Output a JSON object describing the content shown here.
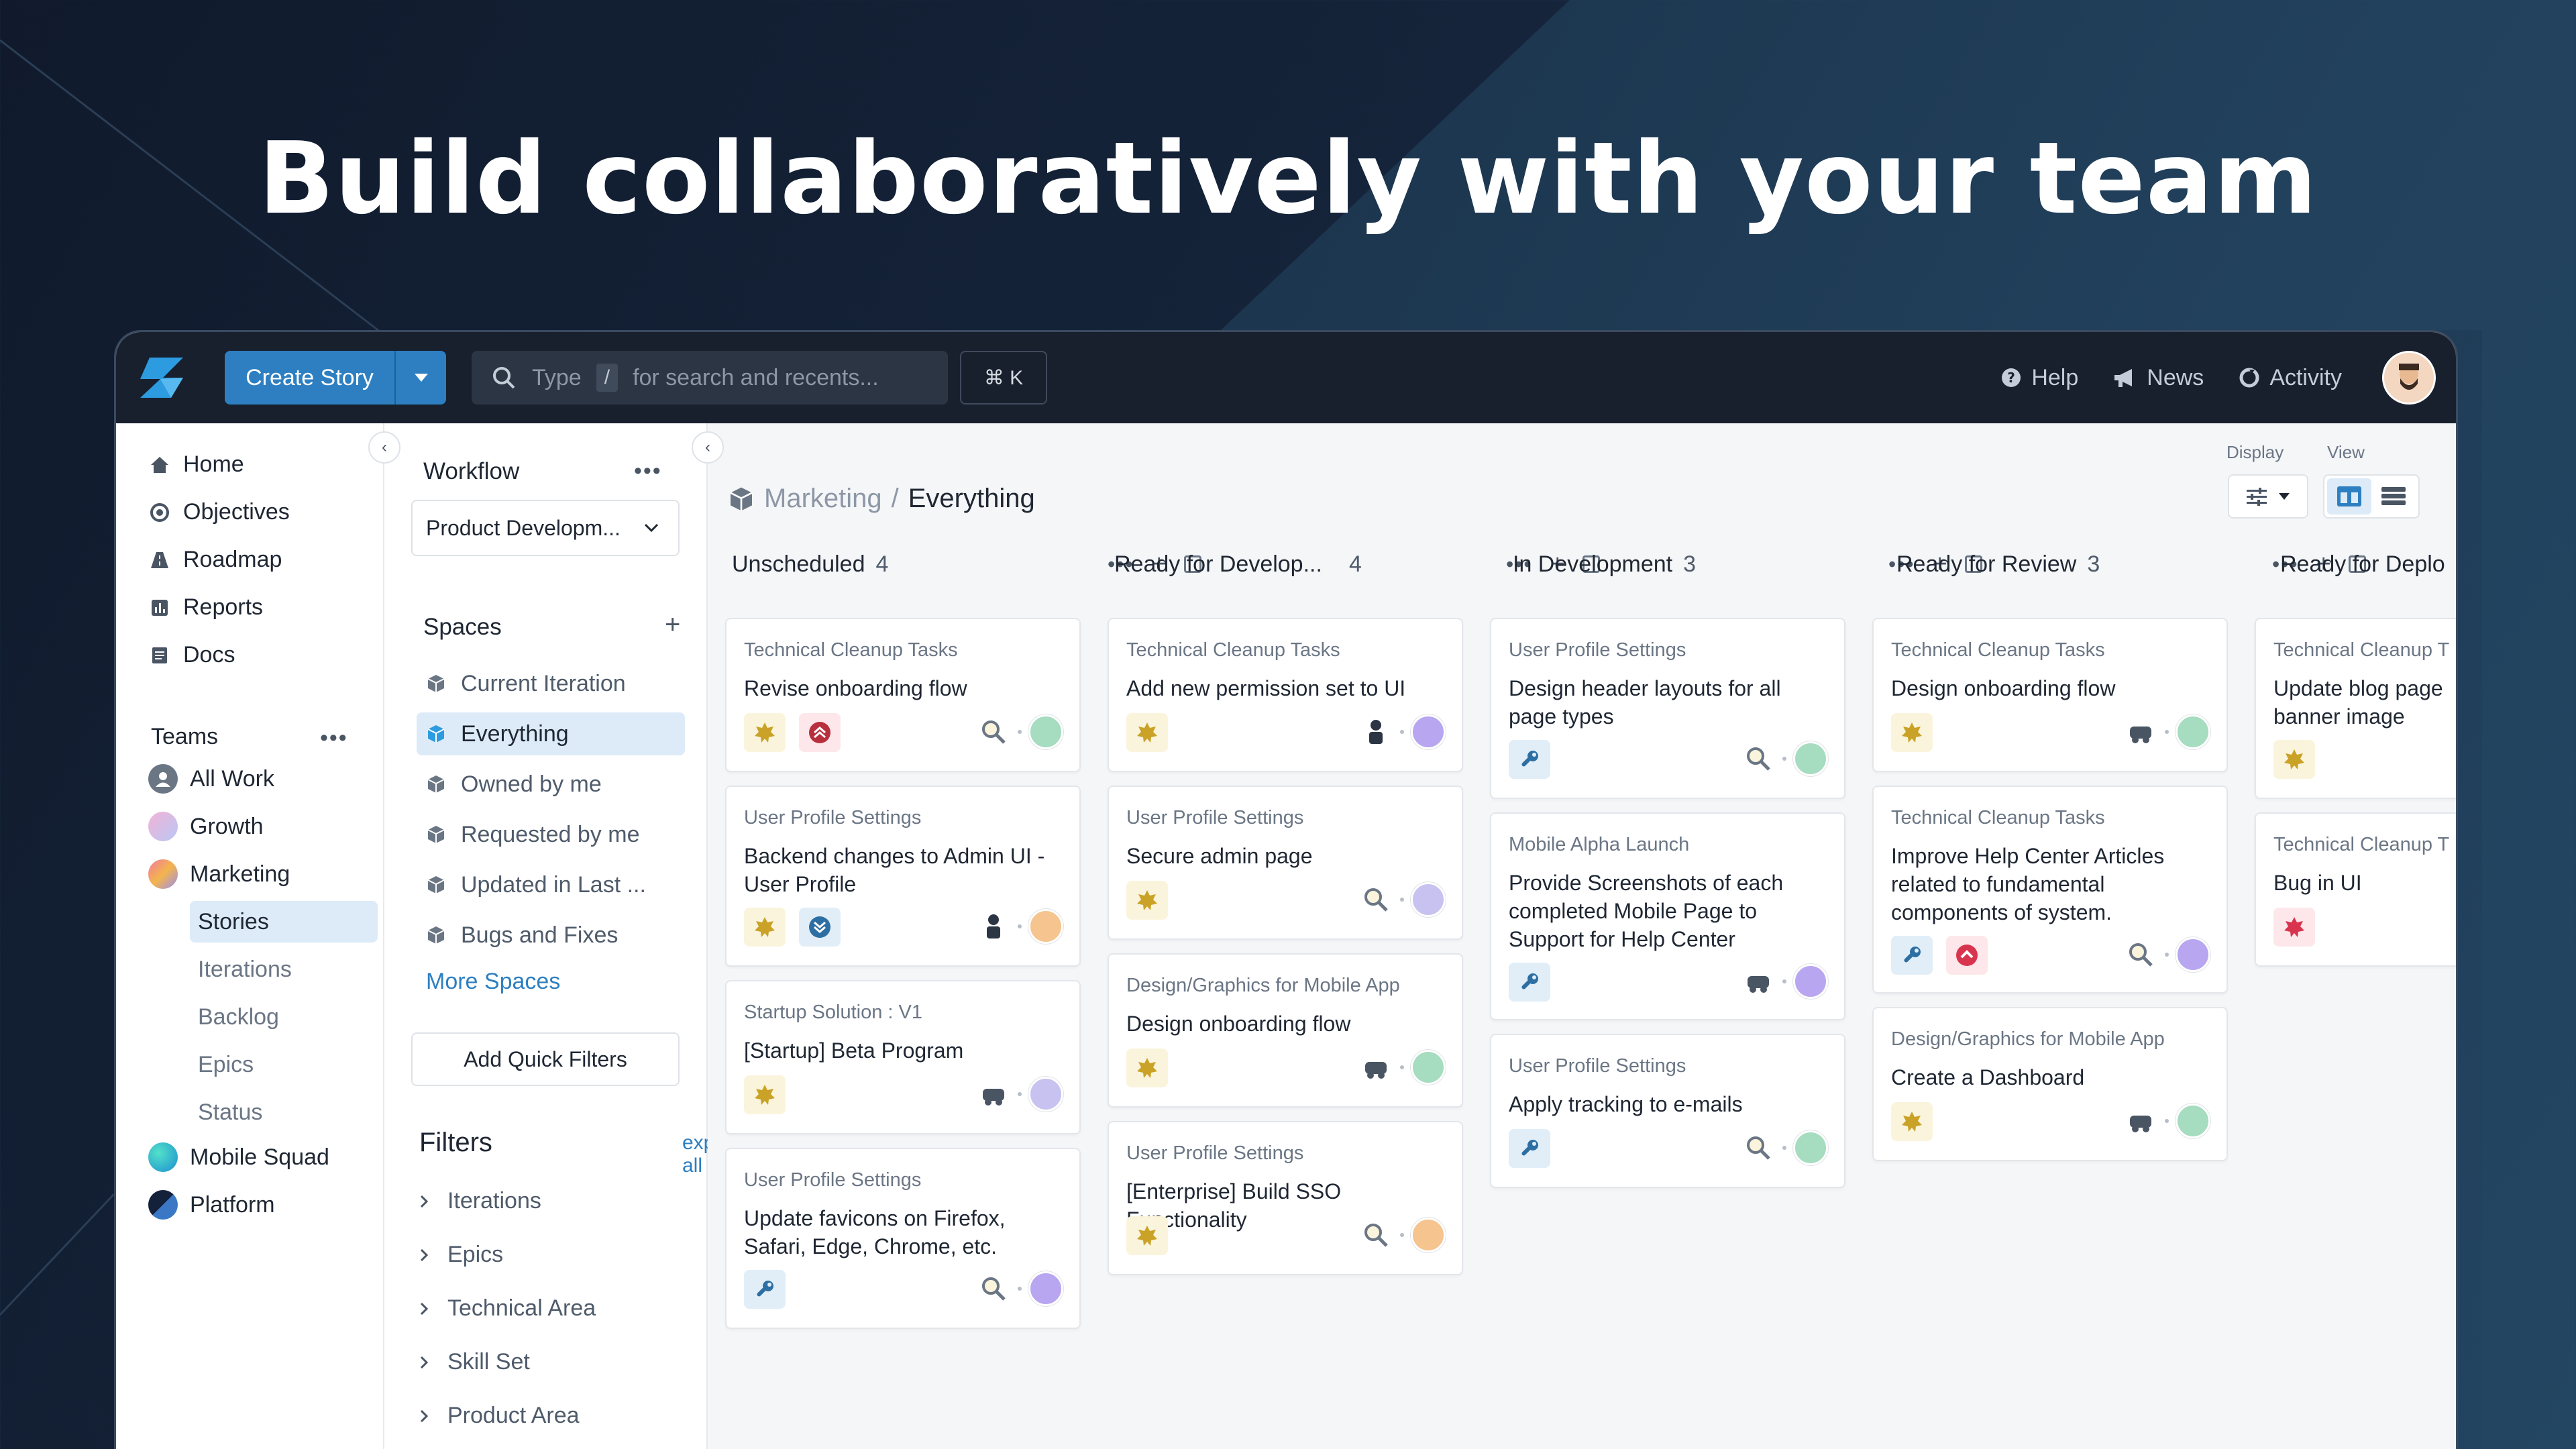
{
  "headline": "Build collaboratively with your team",
  "topbar": {
    "create_label": "Create Story",
    "search_type": "Type",
    "search_slash": "/",
    "search_placeholder": "for search and recents...",
    "shortcut": "⌘ K",
    "help": "Help",
    "news": "News",
    "activity": "Activity"
  },
  "nav": {
    "items": [
      "Home",
      "Objectives",
      "Roadmap",
      "Reports",
      "Docs"
    ],
    "teams_label": "Teams",
    "teams": [
      "All Work",
      "Growth",
      "Marketing",
      "Mobile Squad",
      "Platform"
    ],
    "marketing_sub": [
      "Stories",
      "Iterations",
      "Backlog",
      "Epics",
      "Status"
    ]
  },
  "workflow": {
    "title": "Workflow",
    "selected": "Product Developm...",
    "spaces_label": "Spaces",
    "spaces": [
      "Current Iteration",
      "Everything",
      "Owned by me",
      "Requested by me",
      "Updated in Last ...",
      "Bugs and Fixes"
    ],
    "more_spaces": "More Spaces",
    "quick_filters": "Add Quick Filters",
    "filters_label": "Filters",
    "expand_all": "expand all",
    "filters": [
      "Iterations",
      "Epics",
      "Technical Area",
      "Skill Set",
      "Product Area"
    ]
  },
  "board": {
    "crumb_parent": "Marketing",
    "crumb_sep": "/",
    "crumb_current": "Everything",
    "display_label": "Display",
    "view_label": "View",
    "columns": [
      {
        "name": "Unscheduled",
        "count": "4"
      },
      {
        "name": "Ready for Develop...",
        "count": "4"
      },
      {
        "name": "In Development",
        "count": "3"
      },
      {
        "name": "Ready for Review",
        "count": "3"
      },
      {
        "name": "Ready for Deplo",
        "count": ""
      }
    ],
    "cards": [
      {
        "epic": "Technical Cleanup Tasks",
        "title": "Revise onboarding flow"
      },
      {
        "epic": "User Profile Settings",
        "title": "Backend changes to Admin UI - User Profile"
      },
      {
        "epic": "Startup Solution : V1",
        "title": "[Startup] Beta Program"
      },
      {
        "epic": "User Profile Settings",
        "title": "Update favicons on Firefox, Safari, Edge, Chrome, etc."
      },
      {
        "epic": "Technical Cleanup Tasks",
        "title": "Add new permission set to UI"
      },
      {
        "epic": "User Profile Settings",
        "title": "Secure admin page"
      },
      {
        "epic": "Design/Graphics for Mobile App",
        "title": "Design onboarding flow"
      },
      {
        "epic": "User Profile Settings",
        "title": "[Enterprise] Build SSO Functionality"
      },
      {
        "epic": "User Profile Settings",
        "title": "Design header layouts for all page types"
      },
      {
        "epic": "Mobile Alpha Launch",
        "title": "Provide Screenshots of each completed Mobile Page to Support for Help Center"
      },
      {
        "epic": "User Profile Settings",
        "title": "Apply tracking to e-mails"
      },
      {
        "epic": "Technical Cleanup Tasks",
        "title": "Design onboarding flow"
      },
      {
        "epic": "Technical Cleanup Tasks",
        "title": "Improve Help Center Articles related to fundamental components of system."
      },
      {
        "epic": "Design/Graphics for Mobile App",
        "title": "Create a Dashboard"
      },
      {
        "epic": "Technical Cleanup T",
        "title": "Update blog page banner image"
      },
      {
        "epic": "Technical Cleanup T",
        "title": "Bug in UI"
      }
    ]
  },
  "colors": {
    "accent": "#2d7fc1",
    "topbar": "#18202e",
    "feature": "#c9a227",
    "chore": "#2d6fa3",
    "bug": "#d9344e"
  }
}
